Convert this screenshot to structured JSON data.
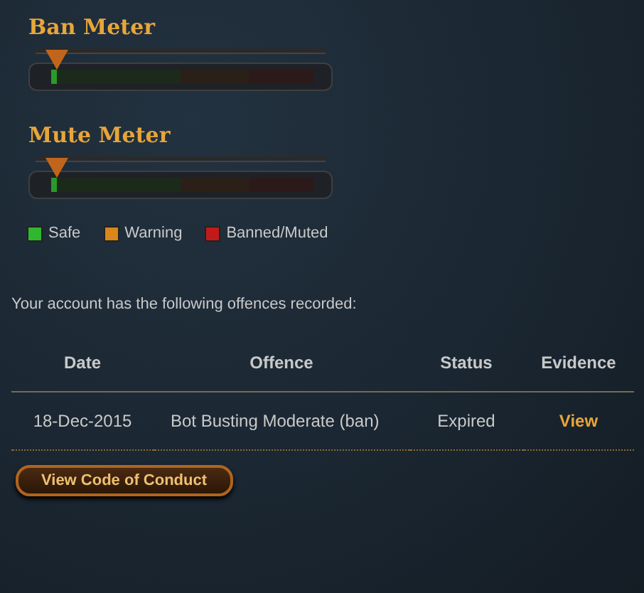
{
  "meters": [
    {
      "title": "Ban Meter",
      "level": 0.02
    },
    {
      "title": "Mute Meter",
      "level": 0.02
    }
  ],
  "legend": [
    {
      "label": "Safe",
      "color": "#2fb82f"
    },
    {
      "label": "Warning",
      "color": "#d9861c"
    },
    {
      "label": "Banned/Muted",
      "color": "#c21a1a"
    }
  ],
  "intro": "Your account has the following offences recorded:",
  "table": {
    "columns": [
      "Date",
      "Offence",
      "Status",
      "Evidence"
    ],
    "rows": [
      {
        "date": "18-Dec-2015",
        "offence": "Bot Busting Moderate (ban)",
        "status": "Expired",
        "evidence": "View"
      }
    ]
  },
  "button": "View Code of Conduct"
}
